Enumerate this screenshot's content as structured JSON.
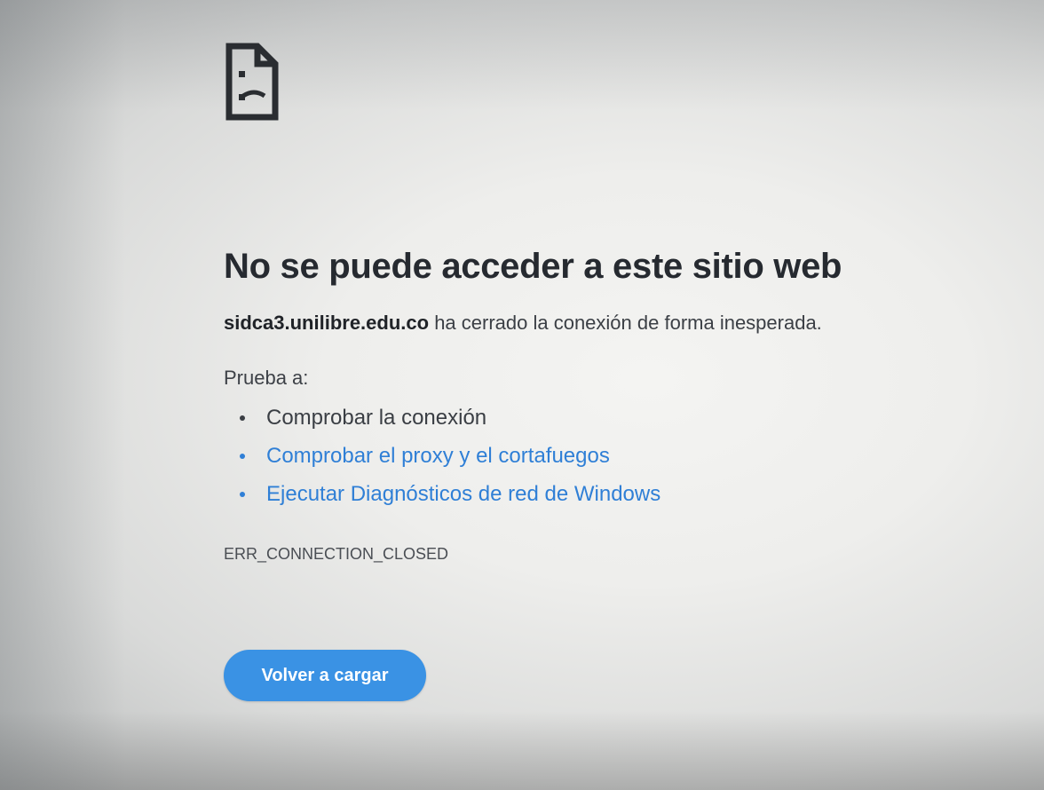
{
  "error_page": {
    "icon": "sad-page-icon",
    "title": "No se puede acceder a este sitio web",
    "domain": "sidca3.unilibre.edu.co",
    "message": " ha cerrado la conexión de forma inesperada.",
    "suggestions_label": "Prueba a:",
    "suggestions": [
      {
        "label": "Comprobar la conexión",
        "is_link": false
      },
      {
        "label": "Comprobar el proxy y el cortafuegos",
        "is_link": true
      },
      {
        "label": "Ejecutar Diagnósticos de red de Windows",
        "is_link": true
      }
    ],
    "error_code": "ERR_CONNECTION_CLOSED",
    "reload_label": "Volver a cargar"
  },
  "colors": {
    "link": "#2f7fd6",
    "button": "#3a92e4",
    "text": "#2b2f35"
  }
}
